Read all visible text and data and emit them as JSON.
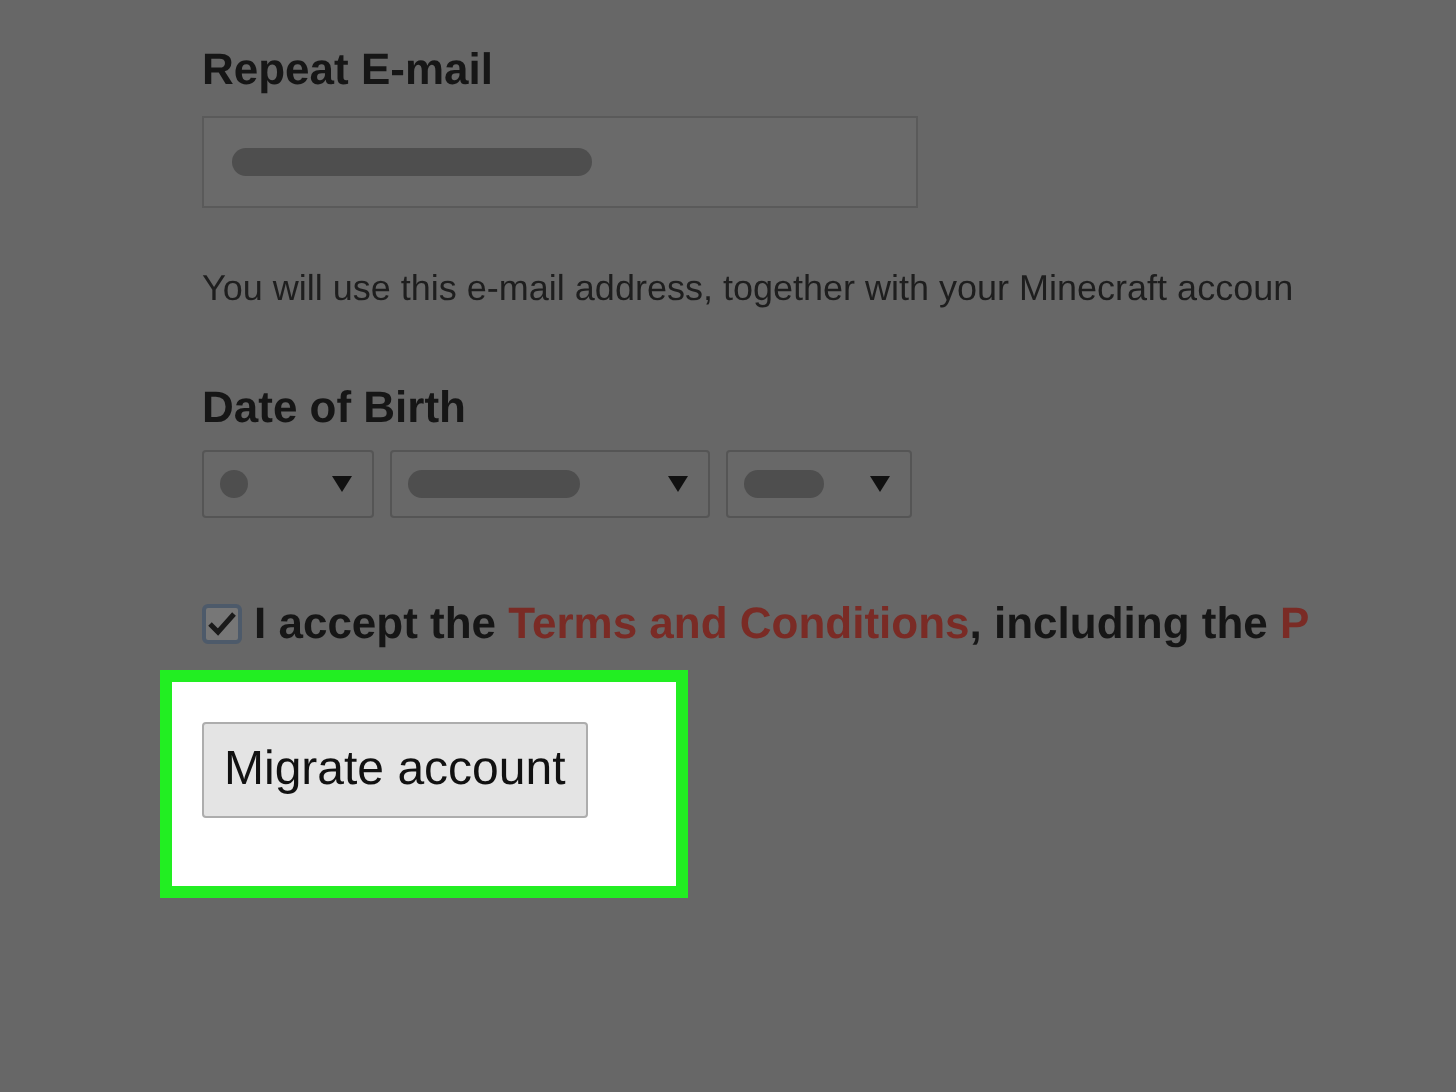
{
  "email_label": "Repeat E-mail",
  "email_field": {
    "redacted": true
  },
  "email_note": "You will use this e-mail address, together with your Minecraft accoun",
  "birth_label": "Date of Birth",
  "birth_selects": [
    {
      "redacted": true
    },
    {
      "redacted": true
    },
    {
      "redacted": true
    }
  ],
  "accept": {
    "checked": true,
    "text_before": "I accept the ",
    "link": "Terms and Conditions",
    "text_after": ", including the ",
    "link_2": "P"
  },
  "migrate_button": {
    "label": "Migrate account",
    "highlighted": true
  }
}
